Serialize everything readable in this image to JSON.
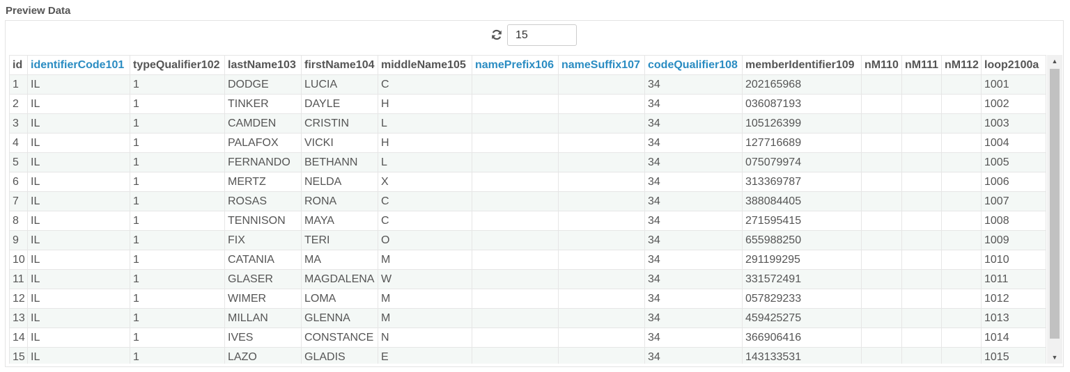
{
  "panel": {
    "title": "Preview Data"
  },
  "toolbar": {
    "refresh_icon": "refresh-icon",
    "row_count": "15"
  },
  "columns": [
    "id",
    "identifierCode101",
    "typeQualifier102",
    "lastName103",
    "firstName104",
    "middleName105",
    "namePrefix106",
    "nameSuffix107",
    "codeQualifier108",
    "memberIdentifier109",
    "nM110",
    "nM111",
    "nM112",
    "loop2100a"
  ],
  "link_columns": [
    "identifierCode101",
    "namePrefix106",
    "nameSuffix107",
    "codeQualifier108"
  ],
  "rows": [
    [
      "1",
      "IL",
      "1",
      "DODGE",
      "LUCIA",
      "C",
      "",
      "",
      "34",
      "202165968",
      "",
      "",
      "",
      "1001"
    ],
    [
      "2",
      "IL",
      "1",
      "TINKER",
      "DAYLE",
      "H",
      "",
      "",
      "34",
      "036087193",
      "",
      "",
      "",
      "1002"
    ],
    [
      "3",
      "IL",
      "1",
      "CAMDEN",
      "CRISTIN",
      "L",
      "",
      "",
      "34",
      "105126399",
      "",
      "",
      "",
      "1003"
    ],
    [
      "4",
      "IL",
      "1",
      "PALAFOX",
      "VICKI",
      "H",
      "",
      "",
      "34",
      "127716689",
      "",
      "",
      "",
      "1004"
    ],
    [
      "5",
      "IL",
      "1",
      "FERNANDO",
      "BETHANN",
      "L",
      "",
      "",
      "34",
      "075079974",
      "",
      "",
      "",
      "1005"
    ],
    [
      "6",
      "IL",
      "1",
      "MERTZ",
      "NELDA",
      "X",
      "",
      "",
      "34",
      "313369787",
      "",
      "",
      "",
      "1006"
    ],
    [
      "7",
      "IL",
      "1",
      "ROSAS",
      "RONA",
      "C",
      "",
      "",
      "34",
      "388084405",
      "",
      "",
      "",
      "1007"
    ],
    [
      "8",
      "IL",
      "1",
      "TENNISON",
      "MAYA",
      "C",
      "",
      "",
      "34",
      "271595415",
      "",
      "",
      "",
      "1008"
    ],
    [
      "9",
      "IL",
      "1",
      "FIX",
      "TERI",
      "O",
      "",
      "",
      "34",
      "655988250",
      "",
      "",
      "",
      "1009"
    ],
    [
      "10",
      "IL",
      "1",
      "CATANIA",
      "MA",
      "M",
      "",
      "",
      "34",
      "291199295",
      "",
      "",
      "",
      "1010"
    ],
    [
      "11",
      "IL",
      "1",
      "GLASER",
      "MAGDALENA",
      "W",
      "",
      "",
      "34",
      "331572491",
      "",
      "",
      "",
      "1011"
    ],
    [
      "12",
      "IL",
      "1",
      "WIMER",
      "LOMA",
      "M",
      "",
      "",
      "34",
      "057829233",
      "",
      "",
      "",
      "1012"
    ],
    [
      "13",
      "IL",
      "1",
      "MILLAN",
      "GLENNA",
      "M",
      "",
      "",
      "34",
      "459425275",
      "",
      "",
      "",
      "1013"
    ],
    [
      "14",
      "IL",
      "1",
      "IVES",
      "CONSTANCE",
      "N",
      "",
      "",
      "34",
      "366906416",
      "",
      "",
      "",
      "1014"
    ],
    [
      "15",
      "IL",
      "1",
      "LAZO",
      "GLADIS",
      "E",
      "",
      "",
      "34",
      "143133531",
      "",
      "",
      "",
      "1015"
    ]
  ],
  "colors": {
    "link": "#2a8cc2",
    "stripe": "#f4f8f6",
    "text": "#555555"
  }
}
